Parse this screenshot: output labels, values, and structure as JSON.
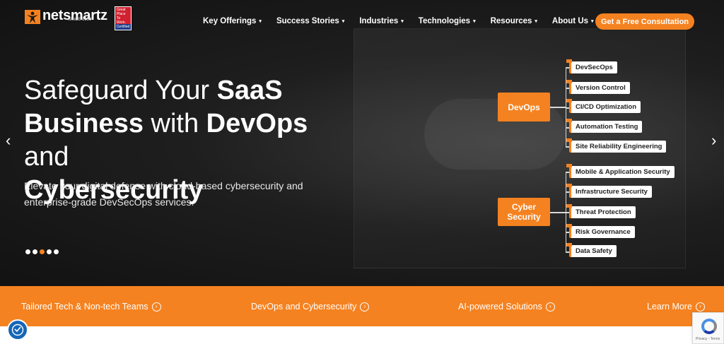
{
  "nav": {
    "logo_text": "netsmartz",
    "logo_sub": "SINCE 1999",
    "badge": {
      "line1": "Great",
      "line2": "Place",
      "line3": "To",
      "line4": "Work.",
      "certified": "Certified"
    },
    "menu": [
      {
        "label": "Key Offerings"
      },
      {
        "label": "Success Stories"
      },
      {
        "label": "Industries"
      },
      {
        "label": "Technologies"
      },
      {
        "label": "Resources"
      },
      {
        "label": "About Us"
      }
    ],
    "cta_label": "Get a Free Consultation",
    "accent": "#f58220"
  },
  "hero": {
    "headline_line1_light": "Safeguard Your",
    "headline_line1_bold": "SaaS",
    "headline_line2_bold": "Business",
    "headline_line2_light": "with",
    "headline_line2_bold2": "DevOps",
    "headline_line2_light2": "and",
    "headline_line3_bold": "Cybersecurity",
    "subtext": "Elevate your digital defense with cloud-based cybersecurity and enterprise-grade DevSecOps services.",
    "prev_arrow": "‹",
    "next_arrow": "›",
    "slide_count": 5,
    "active_slide": 3
  },
  "diagram": {
    "groups": [
      {
        "label": "DevOps",
        "items": [
          "DevSecOps",
          "Version Control",
          "CI/CD Optimization",
          "Automation Testing",
          "Site Reliability Engineering"
        ]
      },
      {
        "label": "Cyber Security",
        "items": [
          "Mobile & Application Security",
          "Infrastructure Security",
          "Threat Protection",
          "Risk Governance",
          "Data Safety"
        ]
      }
    ]
  },
  "bar": {
    "items": [
      "Tailored Tech & Non-tech Teams",
      "DevOps and Cybersecurity",
      "AI-powered Solutions",
      "Learn More"
    ],
    "chevron": "›"
  },
  "widgets": {
    "accessibility_icon": "accessibility-icon",
    "recaptcha_text": "Privacy - Terms"
  }
}
